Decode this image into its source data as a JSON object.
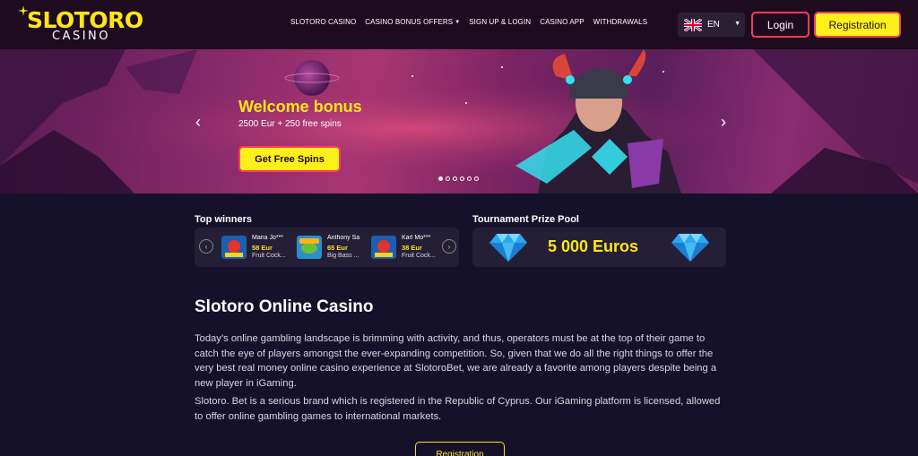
{
  "header": {
    "logo_main": "SLOTORO",
    "logo_sub": "CASINO",
    "nav": [
      {
        "label": "SLOTORO CASINO",
        "has_dropdown": false
      },
      {
        "label": "CASINO BONUS OFFERS",
        "has_dropdown": true
      },
      {
        "label": "SIGN UP & LOGIN",
        "has_dropdown": false
      },
      {
        "label": "CASINO APP",
        "has_dropdown": false
      },
      {
        "label": "WITHDRAWALS",
        "has_dropdown": false
      }
    ],
    "language": "EN",
    "login_label": "Login",
    "registration_label": "Registration"
  },
  "hero": {
    "title": "Welcome bonus",
    "subtitle": "2500 Eur + 250 free spins",
    "cta_label": "Get Free Spins",
    "prev_arrow": "‹",
    "next_arrow": "›",
    "slides_count": 6,
    "active_slide": 1
  },
  "winners": {
    "title": "Top winners",
    "items": [
      {
        "name": "Maria Jo***",
        "amount": "58 Eur",
        "game": "Fruit Cock..."
      },
      {
        "name": "Anthony Sa",
        "amount": "65 Eur",
        "game": "Big Bass ..."
      },
      {
        "name": "Karl Mo***",
        "amount": "38 Eur",
        "game": "Fruit Cock..."
      }
    ]
  },
  "tournament": {
    "title": "Tournament Prize Pool",
    "value": "5 000 Euros"
  },
  "content": {
    "heading": "Slotoro Online Casino",
    "paragraph1": "Today’s online gambling landscape is brimming with activity, and thus, operators must be at the top of their game to catch the eye of players amongst the ever-expanding competition. So, given that we do all the right things to offer the very best real money online casino experience at SlotoroBet, we are already a favorite among players despite being a new player in iGaming.",
    "paragraph2": "Slotoro. Bet is a serious brand which is registered in the Republic of Cyprus. Our iGaming platform is licensed, allowed to offer online gambling games to international markets.",
    "registration_label": "Registration"
  },
  "colors": {
    "accent_yellow": "#ffe51a",
    "accent_red": "#ff3b5c",
    "background": "#16112b",
    "header_bg": "#1d0c1e"
  }
}
